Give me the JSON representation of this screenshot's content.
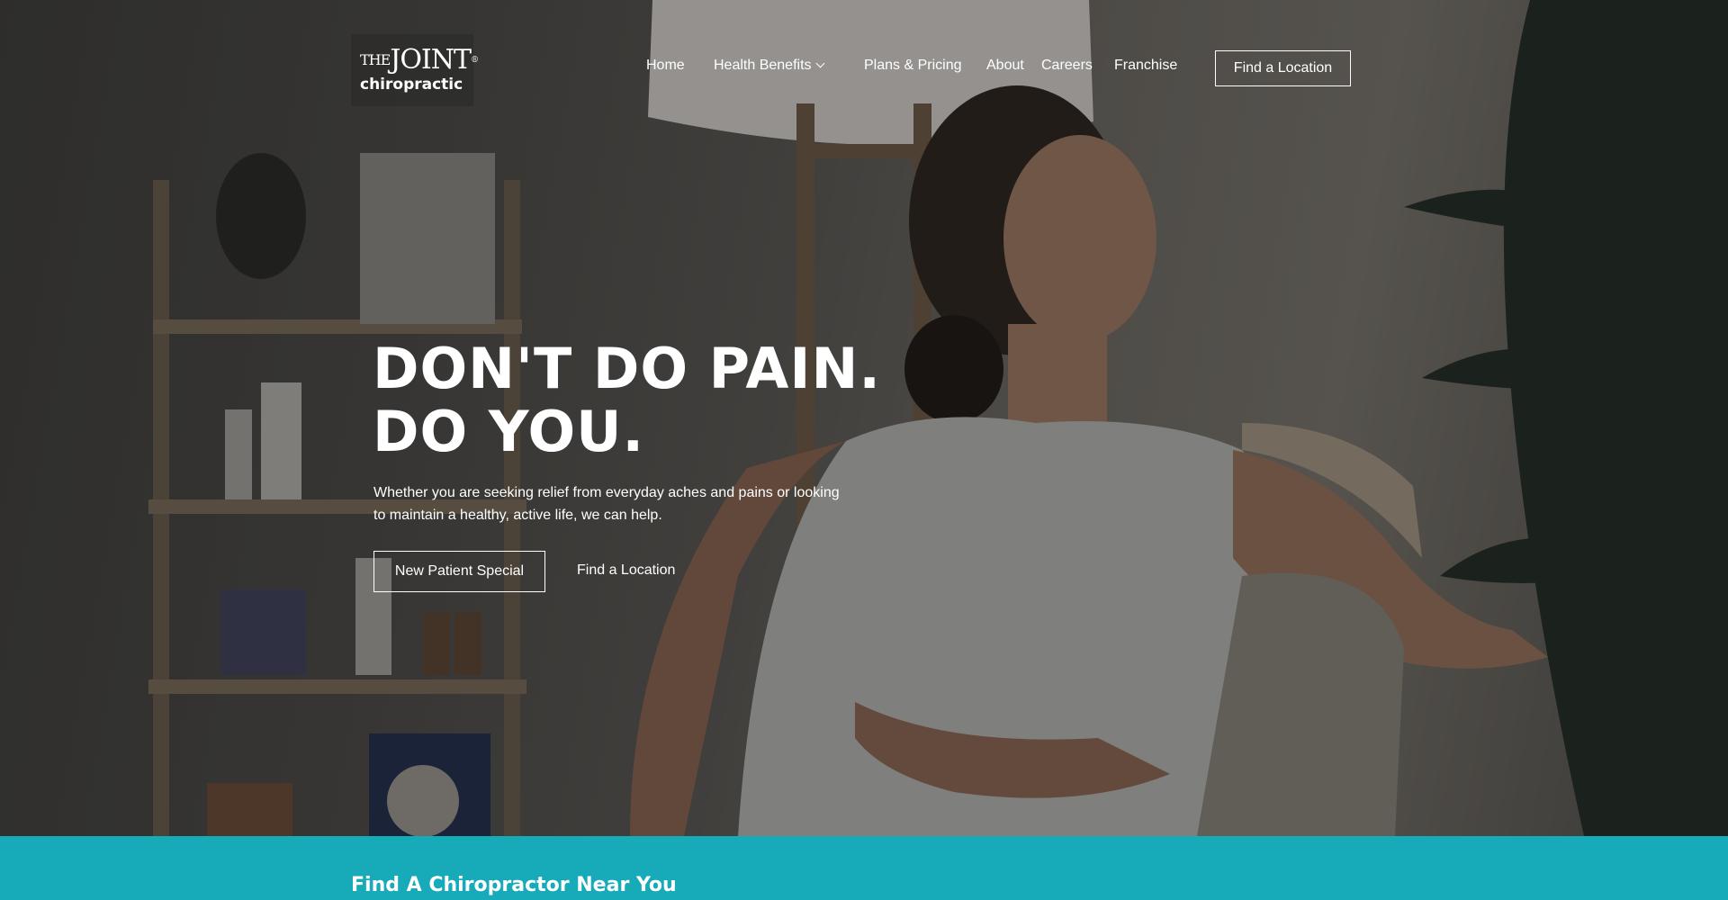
{
  "logo": {
    "line1_the": "THE",
    "line1_joint": "JOINT",
    "line2": "chiropractic",
    "registered": "®"
  },
  "nav": {
    "items": [
      {
        "label": "Home"
      },
      {
        "label": "Health Benefits"
      },
      {
        "label": "Plans & Pricing"
      },
      {
        "label": "About"
      },
      {
        "label": "Careers"
      },
      {
        "label": "Franchise"
      }
    ],
    "cta_label": "Find a Location"
  },
  "hero": {
    "headline_line1": "DON'T DO PAIN.",
    "headline_line2": "DO YOU.",
    "lede": "Whether you are seeking relief from everyday aches and pains or looking to maintain a healthy, active life, we can help.",
    "primary_button": "New Patient Special",
    "secondary_link": "Find a Location"
  },
  "band": {
    "title": "Find A Chiropractor Near You"
  },
  "colors": {
    "teal": "#17aab9",
    "text": "#ffffff"
  }
}
